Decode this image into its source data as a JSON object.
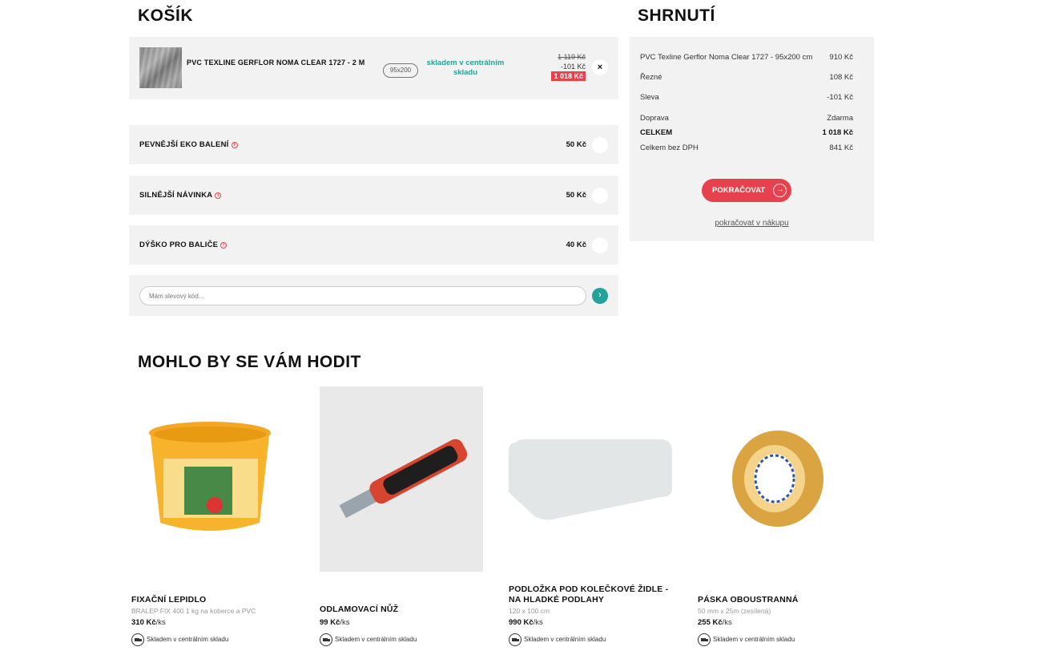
{
  "cart": {
    "title": "KOŠÍK",
    "item": {
      "name": "PVC TEXLINE GERFLOR NOMA CLEAR 1727 - 2 M",
      "size": "95x200",
      "stock": "skladem v centrálním skladu",
      "old_price": "1 119 Kč",
      "discount": "-101 Kč",
      "new_price": "1 018 Kč",
      "remove": "×"
    },
    "extras": [
      {
        "label": "PEVNĚJŠÍ EKO BALENÍ",
        "price": "50 Kč"
      },
      {
        "label": "SILNĚJŠÍ NÁVINKA",
        "price": "50 Kč"
      },
      {
        "label": "DÝŠKO PRO BALIČE",
        "price": "40 Kč"
      }
    ],
    "coupon": {
      "placeholder": "Mám slevový kód..."
    }
  },
  "summary": {
    "title": "SHRNUTÍ",
    "rows": [
      {
        "label": "PVC Texline Gerflor Noma Clear 1727 - 95x200 cm",
        "value": "910 Kč"
      },
      {
        "label": "Řezné",
        "value": "108 Kč"
      },
      {
        "label": "Sleva",
        "value": "-101 Kč"
      },
      {
        "label": "Doprava",
        "value": "Zdarma"
      },
      {
        "label": "CELKEM",
        "value": "1 018 Kč"
      },
      {
        "label": "Celkem bez DPH",
        "value": "841 Kč"
      }
    ],
    "continue_label": "POKRAČOVAT",
    "continue_shopping": "pokračovat v nákupu"
  },
  "recommendations": {
    "title": "MOHLO BY SE VÁM HODIT",
    "products": [
      {
        "name": "FIXAČNÍ LEPIDLO",
        "desc": "BRALEP FIX 400 1 kg na koberce a PVC",
        "price": "310 Kč",
        "unit": "/ks",
        "availability": "Skladem v centrálním skladu"
      },
      {
        "name": "ODLAMOVACÍ NŮŽ",
        "desc": "",
        "price": "99 Kč",
        "unit": "/ks",
        "availability": "Skladem v centrálním skladu"
      },
      {
        "name": "PODLOŽKA POD KOLEČKOVÉ ŽIDLE - NA HLADKÉ PODLAHY",
        "desc": "120 x 100 cm",
        "price": "990 Kč",
        "unit": "/ks",
        "availability": "Skladem v centrálním skladu"
      },
      {
        "name": "PÁSKA OBOUSTRANNÁ",
        "desc": "50 mm x 25m (zesílená)",
        "price": "255 Kč",
        "unit": "/ks",
        "availability": "Skladem v centrálním skladu"
      }
    ]
  },
  "colors": {
    "accent_red": "#e8414e",
    "accent_teal": "#23a29a",
    "panel_bg": "#f2f2f2"
  }
}
